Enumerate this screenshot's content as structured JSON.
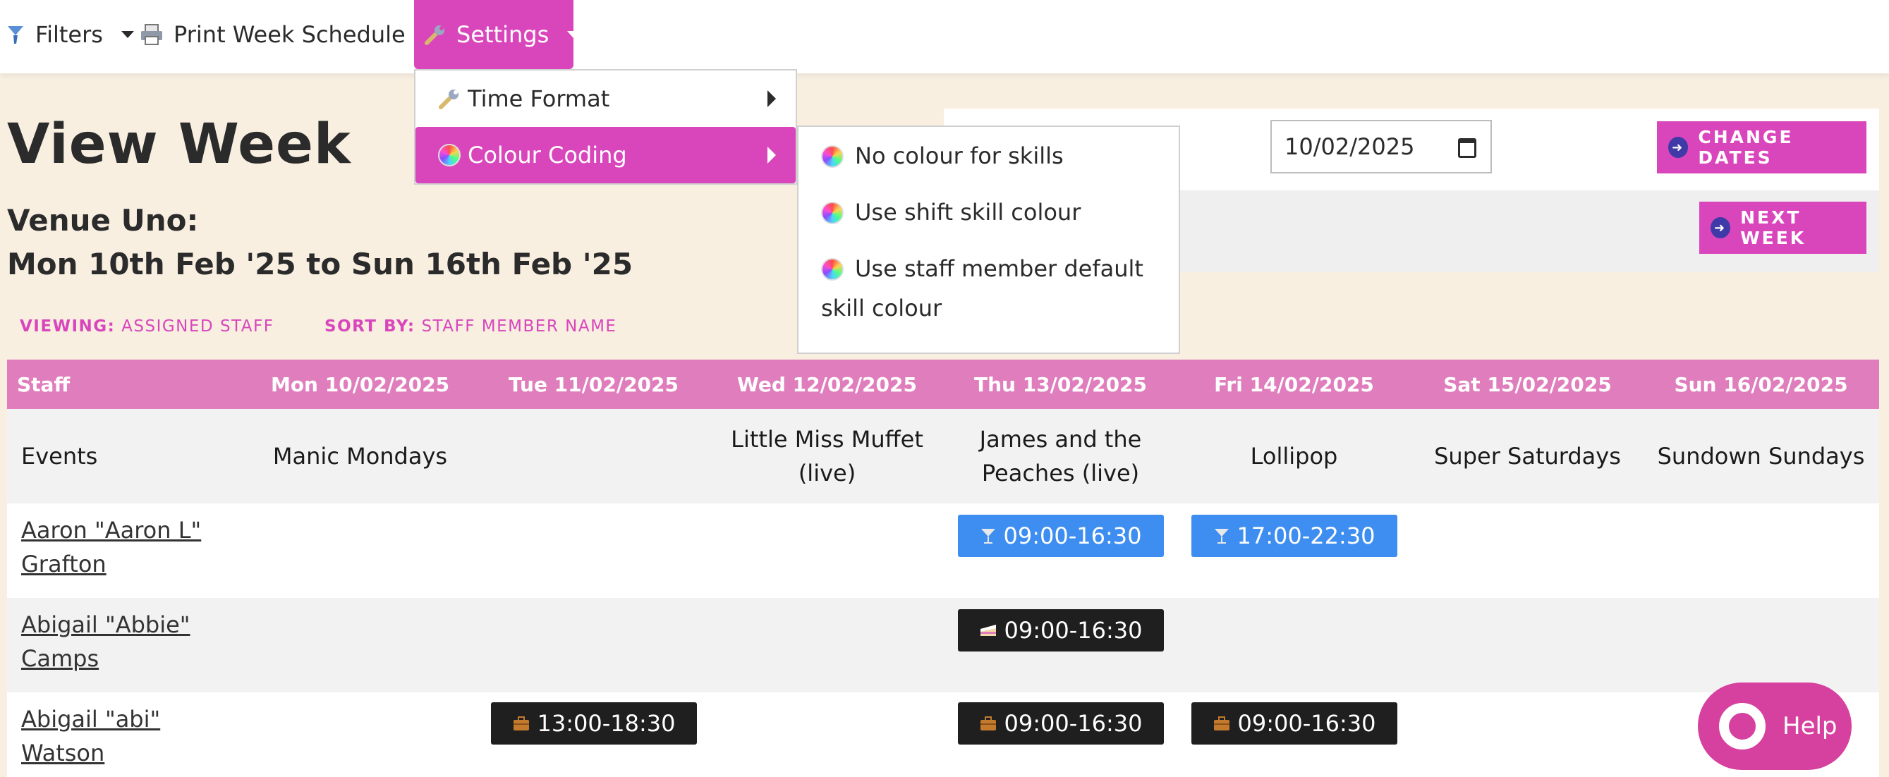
{
  "toolbar": {
    "filters_label": "Filters",
    "print_label": "Print Week Schedule",
    "settings_label": "Settings"
  },
  "settings_menu": {
    "items": [
      {
        "label": "Time Format"
      },
      {
        "label": "Colour Coding"
      }
    ]
  },
  "colour_submenu": {
    "items": [
      {
        "label": "No colour for skills"
      },
      {
        "label": "Use shift skill colour"
      },
      {
        "label": "Use staff member default"
      }
    ],
    "wrap_text": "skill colour"
  },
  "page": {
    "title": "View Week",
    "venue": "Venue Uno:",
    "date_range": "Mon 10th Feb '25 to Sun 16th Feb '25",
    "viewing_label": "VIEWING:",
    "viewing_value": "ASSIGNED STAFF",
    "sort_label": "SORT BY:",
    "sort_value": "STAFF MEMBER NAME"
  },
  "date_picker": {
    "value": "10/02/2025",
    "change_label": "CHANGE DATES",
    "next_label": "NEXT WEEK"
  },
  "table": {
    "headers": [
      "Staff",
      "Mon 10/02/2025",
      "Tue 11/02/2025",
      "Wed 12/02/2025",
      "Thu 13/02/2025",
      "Fri 14/02/2025",
      "Sat 15/02/2025",
      "Sun 16/02/2025"
    ],
    "events_label": "Events",
    "events": [
      "Manic Mondays",
      "",
      "Little Miss Muffet (live)",
      "James and the Peaches (live)",
      "Lollipop",
      "Super Saturdays",
      "Sundown Sundays"
    ],
    "rows": [
      {
        "name": "Aaron \"Aaron L\" Grafton",
        "shifts": [
          "",
          "",
          "",
          "09:00-16:30",
          "17:00-22:30",
          "",
          ""
        ]
      },
      {
        "name": "Abigail \"Abbie\" Camps",
        "shifts": [
          "",
          "",
          "",
          "09:00-16:30",
          "",
          "",
          ""
        ]
      },
      {
        "name": "Abigail \"abi\" Watson",
        "shifts": [
          "",
          "13:00-18:30",
          "",
          "09:00-16:30",
          "09:00-16:30",
          "",
          ""
        ]
      }
    ]
  },
  "help": {
    "label": "Help"
  },
  "colors": {
    "accent": "#d946bc",
    "header": "#e07ebd",
    "shift_blue": "#3d8ef0",
    "shift_black": "#1f1f1f"
  }
}
